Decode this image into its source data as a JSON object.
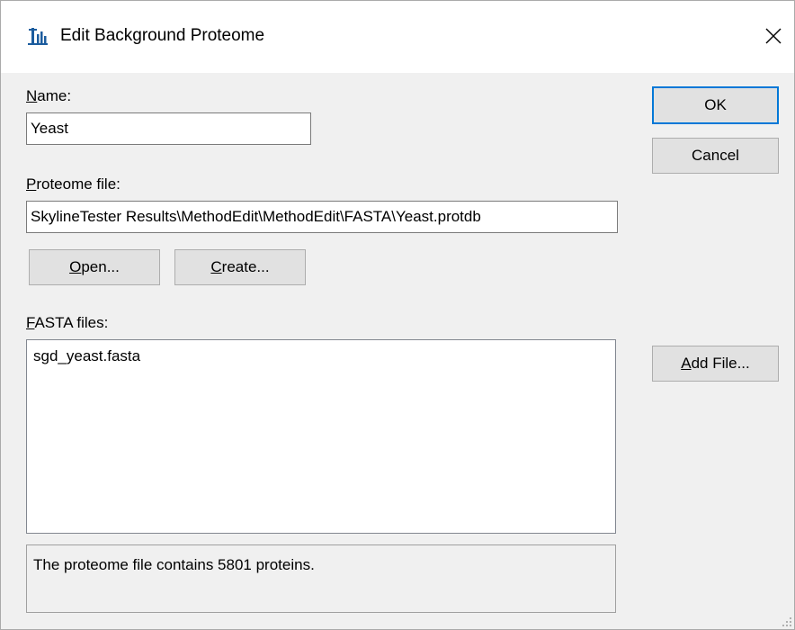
{
  "dialog": {
    "title": "Edit Background Proteome",
    "app_icon": "skyline-icon",
    "close_icon": "close-icon"
  },
  "name": {
    "label_first": "N",
    "label_rest": "ame:",
    "value": "Yeast"
  },
  "proteome_file": {
    "label_first": "P",
    "label_rest": "roteome file:",
    "value": "SkylineTester Results\\MethodEdit\\MethodEdit\\FASTA\\Yeast.protdb"
  },
  "buttons": {
    "ok": "OK",
    "cancel": "Cancel",
    "open_first": "O",
    "open_rest": "pen...",
    "create_first": "C",
    "create_rest": "reate...",
    "add_file_first": "A",
    "add_file_rest": "dd File..."
  },
  "fasta_files": {
    "label_first": "F",
    "label_rest": "ASTA files:",
    "items": [
      "sgd_yeast.fasta"
    ]
  },
  "status": {
    "text": "The proteome file contains 5801 proteins."
  },
  "colors": {
    "accent": "#0078d7",
    "dialog_bg": "#f0f0f0",
    "button_bg": "#e1e1e1",
    "icon_blue": "#1c5c9e"
  }
}
